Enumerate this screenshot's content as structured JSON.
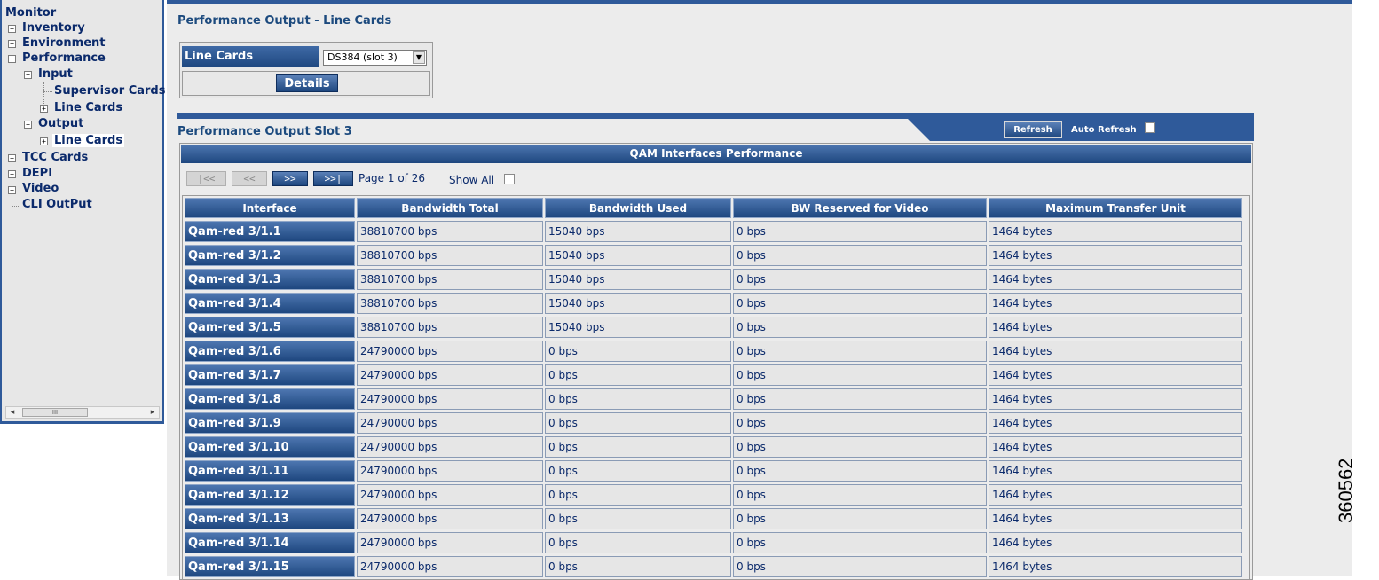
{
  "tree": {
    "root": "Monitor",
    "items": {
      "inventory": "Inventory",
      "environment": "Environment",
      "performance": "Performance",
      "input": "Input",
      "supervisor_cards": "Supervisor Cards",
      "input_line_cards": "Line Cards",
      "output": "Output",
      "output_line_cards": "Line Cards",
      "tcc_cards": "TCC Cards",
      "depi": "DEPI",
      "video": "Video",
      "cli_output": "CLI OutPut"
    },
    "scrollbar_grip": "III"
  },
  "page": {
    "title": "Performance Output - Line Cards"
  },
  "selector": {
    "label": "Line Cards",
    "selected": "DS384 (slot 3)",
    "details_label": "Details"
  },
  "section": {
    "title": "Performance Output Slot 3",
    "refresh_label": "Refresh",
    "auto_refresh_label": "Auto Refresh",
    "auto_refresh_checked": false
  },
  "qam": {
    "header": "QAM Interfaces Performance",
    "pager": {
      "first": "|<<",
      "prev": "<<",
      "next": ">>",
      "last": ">>|"
    },
    "page_info": "Page 1 of 26",
    "show_all_label": "Show All",
    "show_all_checked": false,
    "columns": [
      "Interface",
      "Bandwidth Total",
      "Bandwidth Used",
      "BW Reserved for Video",
      "Maximum Transfer Unit"
    ],
    "rows": [
      [
        "Qam-red 3/1.1",
        "38810700 bps",
        "15040 bps",
        "0 bps",
        "1464 bytes"
      ],
      [
        "Qam-red 3/1.2",
        "38810700 bps",
        "15040 bps",
        "0 bps",
        "1464 bytes"
      ],
      [
        "Qam-red 3/1.3",
        "38810700 bps",
        "15040 bps",
        "0 bps",
        "1464 bytes"
      ],
      [
        "Qam-red 3/1.4",
        "38810700 bps",
        "15040 bps",
        "0 bps",
        "1464 bytes"
      ],
      [
        "Qam-red 3/1.5",
        "38810700 bps",
        "15040 bps",
        "0 bps",
        "1464 bytes"
      ],
      [
        "Qam-red 3/1.6",
        "24790000 bps",
        "0 bps",
        "0 bps",
        "1464 bytes"
      ],
      [
        "Qam-red 3/1.7",
        "24790000 bps",
        "0 bps",
        "0 bps",
        "1464 bytes"
      ],
      [
        "Qam-red 3/1.8",
        "24790000 bps",
        "0 bps",
        "0 bps",
        "1464 bytes"
      ],
      [
        "Qam-red 3/1.9",
        "24790000 bps",
        "0 bps",
        "0 bps",
        "1464 bytes"
      ],
      [
        "Qam-red 3/1.10",
        "24790000 bps",
        "0 bps",
        "0 bps",
        "1464 bytes"
      ],
      [
        "Qam-red 3/1.11",
        "24790000 bps",
        "0 bps",
        "0 bps",
        "1464 bytes"
      ],
      [
        "Qam-red 3/1.12",
        "24790000 bps",
        "0 bps",
        "0 bps",
        "1464 bytes"
      ],
      [
        "Qam-red 3/1.13",
        "24790000 bps",
        "0 bps",
        "0 bps",
        "1464 bytes"
      ],
      [
        "Qam-red 3/1.14",
        "24790000 bps",
        "0 bps",
        "0 bps",
        "1464 bytes"
      ],
      [
        "Qam-red 3/1.15",
        "24790000 bps",
        "0 bps",
        "0 bps",
        "1464 bytes"
      ]
    ]
  },
  "figure_number": "360562"
}
